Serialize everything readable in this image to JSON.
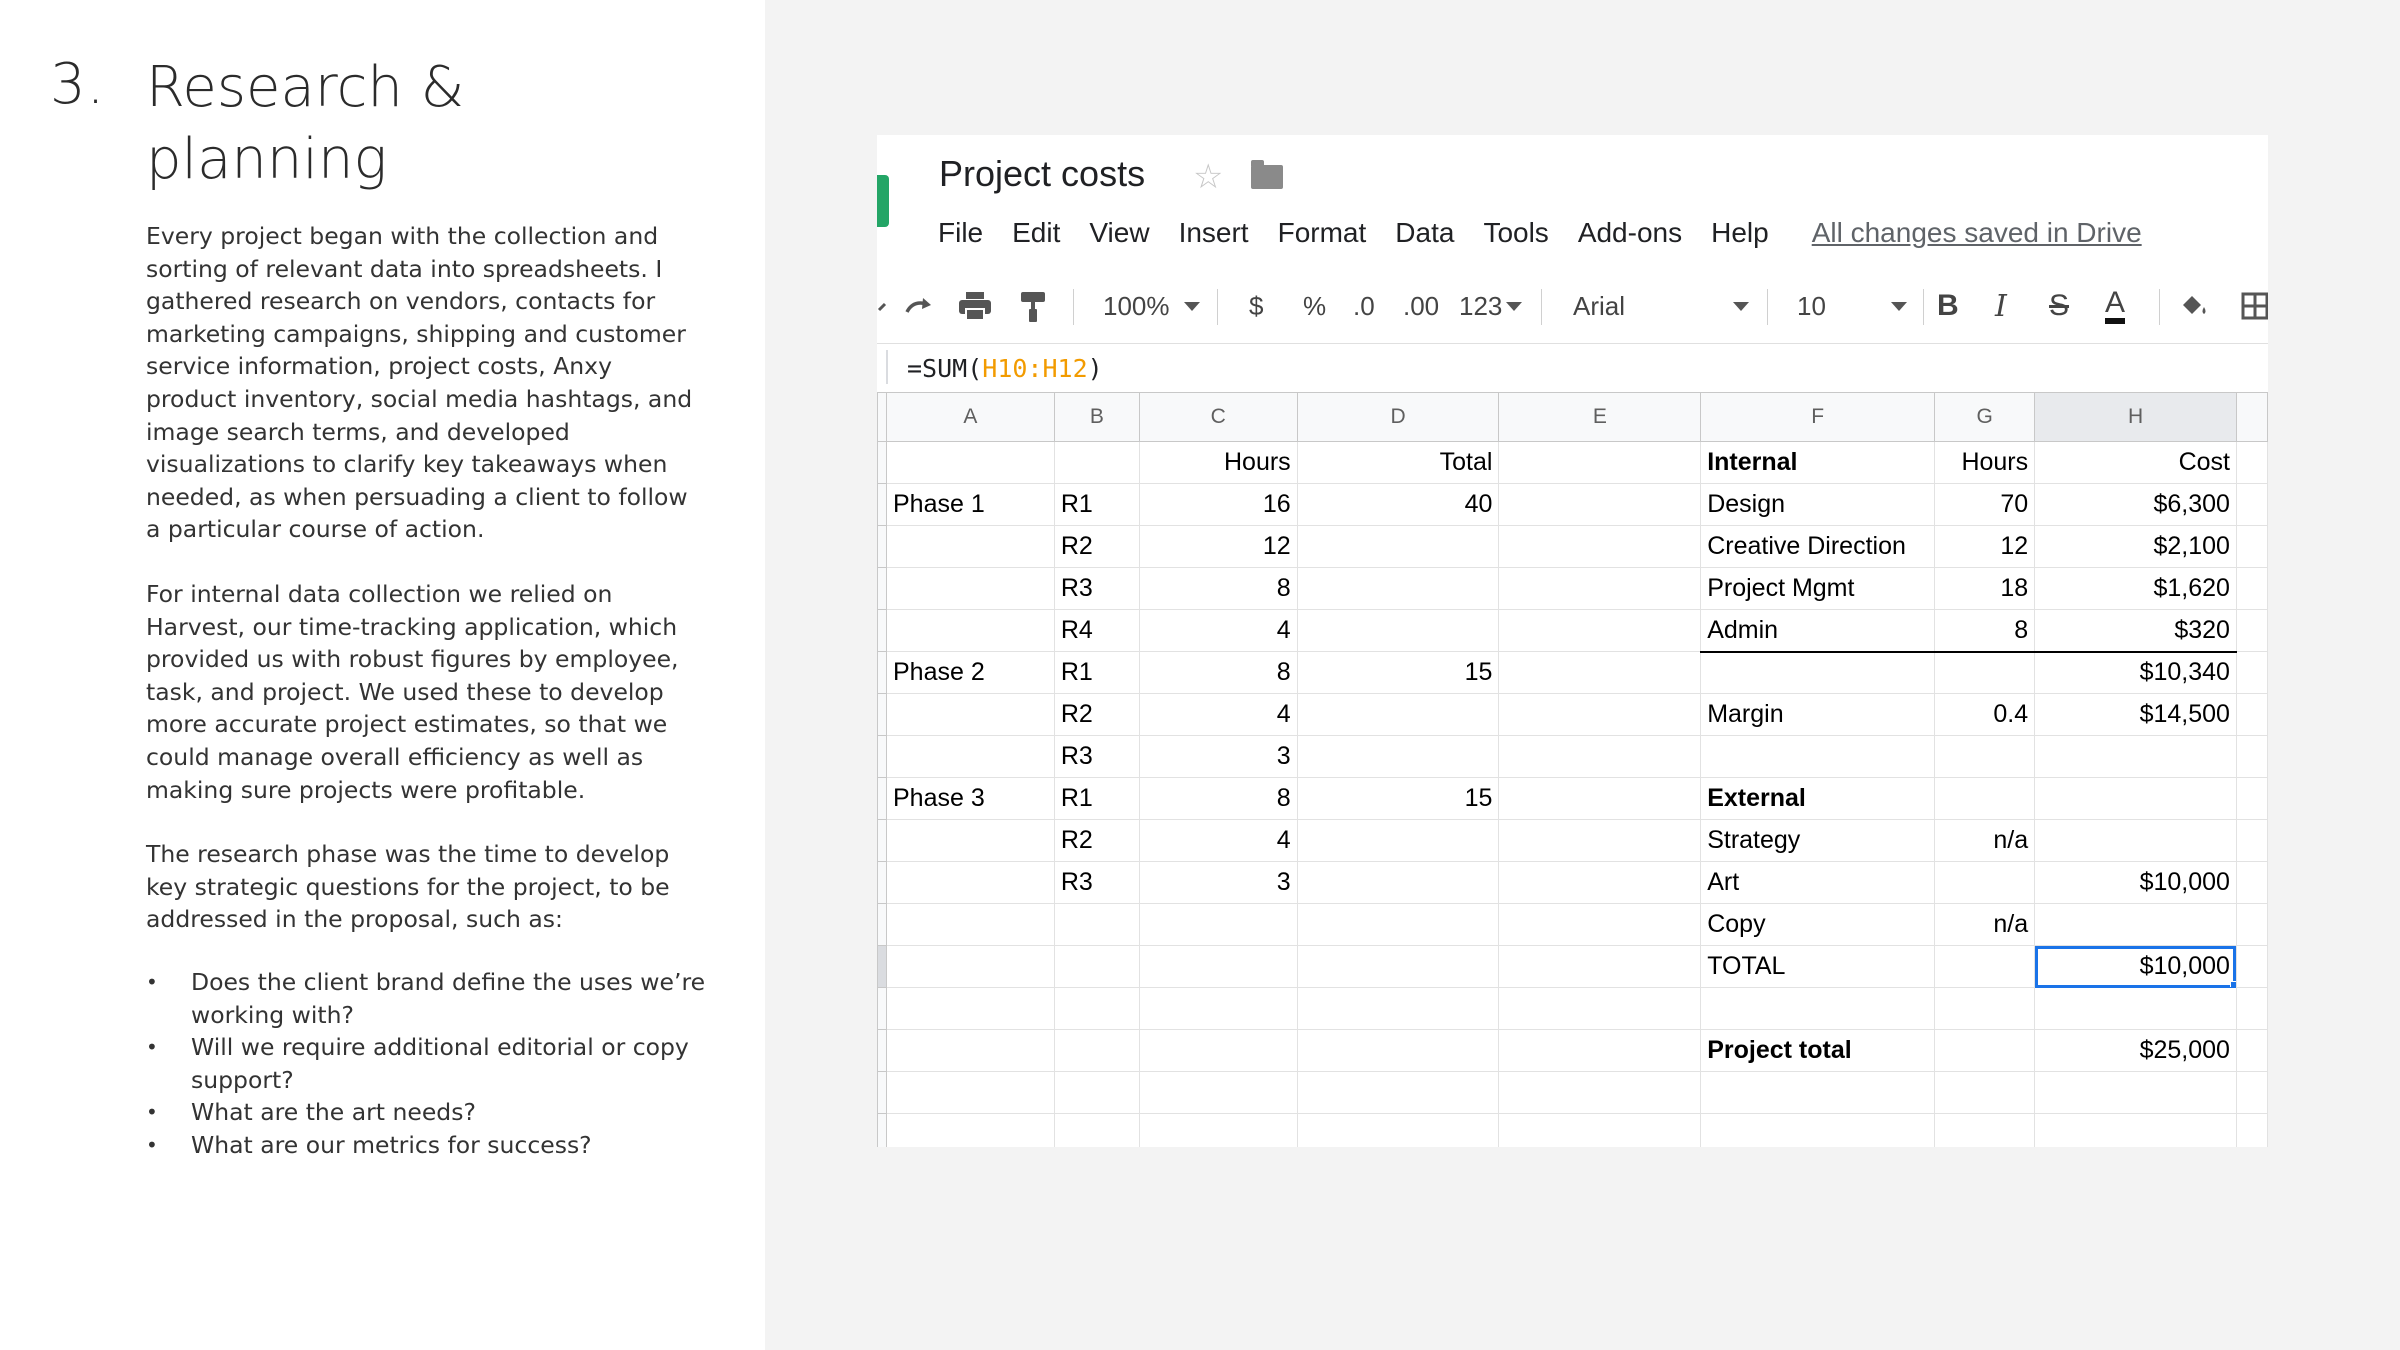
{
  "section": {
    "number": "3.",
    "title": "Research & planning"
  },
  "paragraphs": {
    "p1": "Every project began with the collection and sorting of relevant data into spreadsheets. I gathered research on vendors, contacts for marketing campaigns, shipping and customer service information, project costs, Anxy product inventory, social media hashtags, and image search terms, and developed visualizations to clarify key takeaways when needed, as when persuading a client to follow a particular course of action.",
    "p2": "For internal data collection we relied on Harvest, our time-tracking application, which provided us with robust figures by employee, task, and project. We used these to develop more accurate project estimates, so that we could manage overall efficiency as well as making sure projects were profitable.",
    "p3": "The research phase was the time to develop key strategic questions for the project, to be addressed in the proposal, such as:"
  },
  "bullets": [
    "Does the client brand define the uses we’re working with?",
    "Will we require additional editorial or copy support?",
    "What are the art needs?",
    "What are our metrics for success?"
  ],
  "sheet": {
    "title": "Project costs",
    "menu": [
      "File",
      "Edit",
      "View",
      "Insert",
      "Format",
      "Data",
      "Tools",
      "Add-ons",
      "Help"
    ],
    "saved_status": "All changes saved in Drive",
    "toolbar": {
      "zoom": "100%",
      "currency": "$",
      "percent": "%",
      "dec_decrease": ".0",
      "dec_increase": ".00",
      "more_formats": "123",
      "font": "Arial",
      "font_size": "10",
      "bold": "B",
      "italic": "I",
      "strike": "S",
      "text_color": "A"
    },
    "formula": {
      "prefix": "=SUM(",
      "range": "H10:H12",
      "suffix": ")"
    },
    "columns": [
      "A",
      "B",
      "C",
      "D",
      "E",
      "F",
      "G",
      "H"
    ],
    "rows": [
      [
        "",
        "",
        "Hours",
        "Total",
        "",
        "Internal",
        "Hours",
        "Cost"
      ],
      [
        "Phase 1",
        "R1",
        "16",
        "40",
        "",
        "Design",
        "70",
        "$6,300"
      ],
      [
        "",
        "R2",
        "12",
        "",
        "",
        "Creative Direction",
        "12",
        "$2,100"
      ],
      [
        "",
        "R3",
        "8",
        "",
        "",
        "Project Mgmt",
        "18",
        "$1,620"
      ],
      [
        "",
        "R4",
        "4",
        "",
        "",
        "Admin",
        "8",
        "$320"
      ],
      [
        "Phase 2",
        "R1",
        "8",
        "15",
        "",
        "",
        "",
        "$10,340"
      ],
      [
        "",
        "R2",
        "4",
        "",
        "",
        "Margin",
        "0.4",
        "$14,500"
      ],
      [
        "",
        "R3",
        "3",
        "",
        "",
        "",
        "",
        ""
      ],
      [
        "Phase 3",
        "R1",
        "8",
        "15",
        "",
        "External",
        "",
        ""
      ],
      [
        "",
        "R2",
        "4",
        "",
        "",
        "Strategy",
        "n/a",
        ""
      ],
      [
        "",
        "R3",
        "3",
        "",
        "",
        "Art",
        "",
        "$10,000"
      ],
      [
        "",
        "",
        "",
        "",
        "",
        "Copy",
        "n/a",
        ""
      ],
      [
        "",
        "",
        "",
        "",
        "",
        "TOTAL",
        "",
        "$10,000"
      ],
      [
        "",
        "",
        "",
        "",
        "",
        "",
        "",
        ""
      ],
      [
        "",
        "",
        "",
        "",
        "",
        "Project total",
        "",
        "$25,000"
      ],
      [
        "",
        "",
        "",
        "",
        "",
        "",
        "",
        ""
      ],
      [
        "",
        "",
        "",
        "",
        "",
        "",
        "",
        ""
      ]
    ],
    "colors": {
      "selection": "#1a73e8",
      "formula_range": "#f29b00",
      "app_icon": "#23a566"
    }
  }
}
